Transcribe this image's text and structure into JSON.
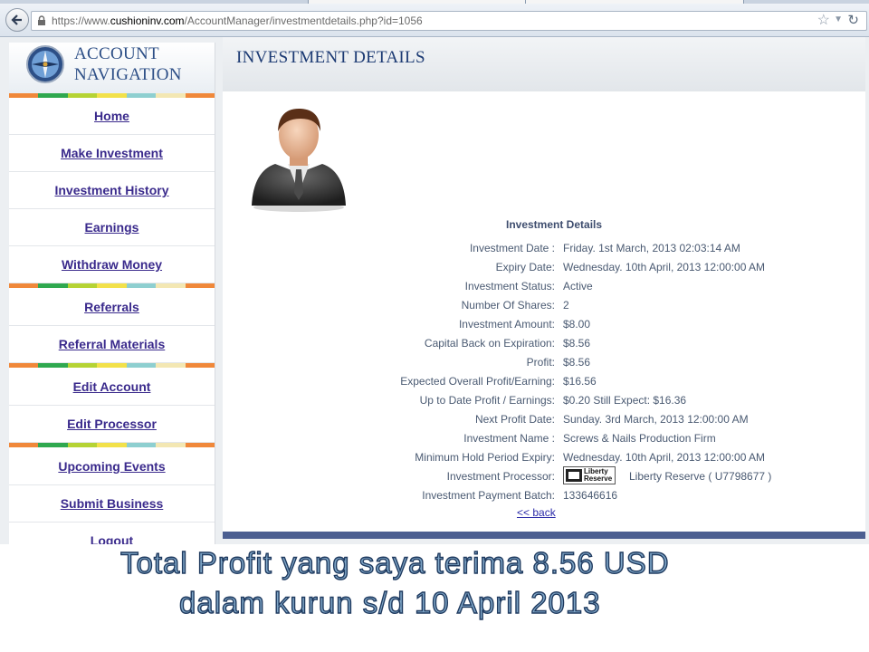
{
  "browser": {
    "url_prefix": "https://www.",
    "url_domain": "cushioninv.com",
    "url_path": "/AccountManager/investmentdetails.php?id=1056"
  },
  "sidebar": {
    "title_line1": "ACCOUNT",
    "title_line2": "NAVIGATION",
    "items": [
      {
        "label": "Home"
      },
      {
        "label": "Make Investment"
      },
      {
        "label": "Investment History"
      },
      {
        "label": "Earnings"
      },
      {
        "label": "Withdraw Money"
      },
      {
        "label": "Referrals"
      },
      {
        "label": "Referral Materials"
      },
      {
        "label": "Edit Account"
      },
      {
        "label": "Edit Processor"
      },
      {
        "label": "Upcoming Events"
      },
      {
        "label": "Submit Business"
      },
      {
        "label": "Logout"
      }
    ],
    "stripe_colors": [
      "#f0883a",
      "#2fa84f",
      "#b5d334",
      "#f2e14a",
      "#8ecfd0",
      "#f3e7b3",
      "#f0883a"
    ]
  },
  "main": {
    "title": "INVESTMENT DETAILS",
    "details_heading": "Investment Details",
    "rows": [
      {
        "label": "Investment Date :",
        "value": "Friday. 1st March, 2013 02:03:14 AM"
      },
      {
        "label": "Expiry Date:",
        "value": "Wednesday. 10th April, 2013 12:00:00 AM"
      },
      {
        "label": "Investment Status:",
        "value": "Active"
      },
      {
        "label": "Number Of Shares:",
        "value": "2"
      },
      {
        "label": "Investment Amount:",
        "value": "$8.00"
      },
      {
        "label": "Capital Back on Expiration:",
        "value": "$8.56"
      },
      {
        "label": "Profit:",
        "value": "$8.56"
      },
      {
        "label": "Expected Overall Profit/Earning:",
        "value": "$16.56"
      },
      {
        "label": "Up to Date Profit / Earnings:",
        "value": "$0.20 Still Expect: $16.36"
      },
      {
        "label": "Next Profit Date:",
        "value": "Sunday. 3rd March, 2013 12:00:00 AM"
      },
      {
        "label": "Investment Name :",
        "value": "Screws & Nails Production Firm"
      },
      {
        "label": "Minimum Hold Period Expiry:",
        "value": "Wednesday. 10th April, 2013 12:00:00 AM"
      },
      {
        "label": "Investment Processor:",
        "value": "Liberty Reserve ( U7798677 )",
        "logo_line1": "Liberty",
        "logo_line2": "Reserve"
      },
      {
        "label": "Investment Payment Batch:",
        "value": "133646616"
      }
    ],
    "back_link": "<< back"
  },
  "caption": {
    "line1": "Total Profit yang saya terima 8.56 USD",
    "line2": "dalam kurun s/d 10 April 2013"
  }
}
